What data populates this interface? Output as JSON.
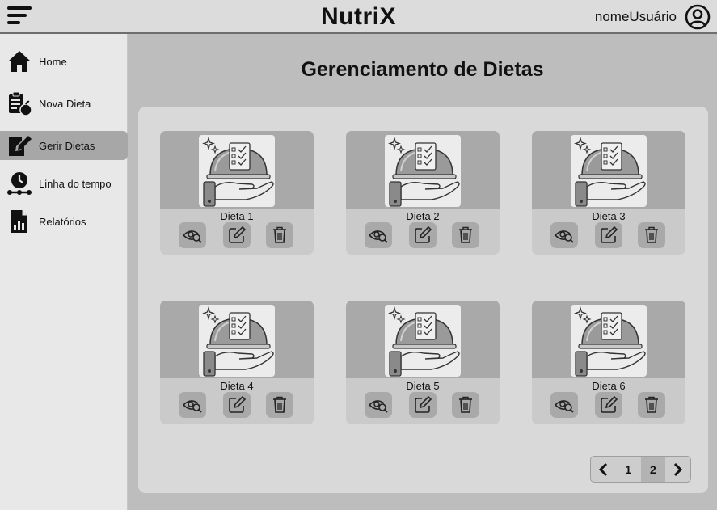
{
  "header": {
    "brand": "NutriX",
    "username": "nomeUsuário",
    "menu_icon": "hamburger-menu-icon",
    "user_icon": "user-circle-icon"
  },
  "sidebar": {
    "items": [
      {
        "label": "Home",
        "icon": "home-icon",
        "active": false
      },
      {
        "label": "Nova Dieta",
        "icon": "clipboard-apple-icon",
        "active": false
      },
      {
        "label": "Gerir Dietas",
        "icon": "edit-document-icon",
        "active": true
      },
      {
        "label": "Linha do tempo",
        "icon": "clock-timeline-icon",
        "active": false
      },
      {
        "label": "Relatórios",
        "icon": "report-chart-icon",
        "active": false
      }
    ]
  },
  "main": {
    "title": "Gerenciamento de Dietas",
    "cards": [
      {
        "name": "Dieta 1"
      },
      {
        "name": "Dieta 2"
      },
      {
        "name": "Dieta 3"
      },
      {
        "name": "Dieta 4"
      },
      {
        "name": "Dieta 5"
      },
      {
        "name": "Dieta 6"
      }
    ],
    "card_icon": "serving-cloche-checklist-icon",
    "card_actions": [
      "view-icon",
      "edit-icon",
      "trash-icon"
    ]
  },
  "pagination": {
    "pages": [
      "1",
      "2"
    ],
    "current": "2",
    "prev_icon": "chevron-left-icon",
    "next_icon": "chevron-right-icon"
  },
  "colors": {
    "header_bg": "#dcdcdc",
    "sidebar_bg": "#e8e8e8",
    "main_bg": "#bdbdbd",
    "panel_bg": "#d9d9d9",
    "active_item": "#a7a7a7"
  }
}
